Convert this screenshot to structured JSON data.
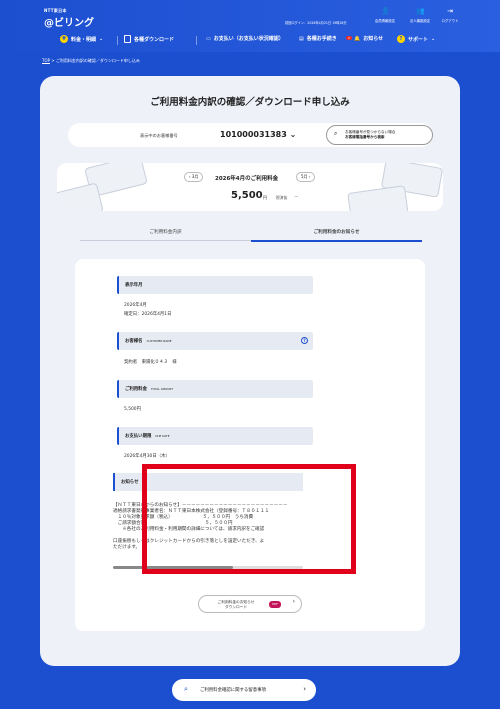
{
  "header": {
    "logo_top": "NTT東日本",
    "logo_main": "@ビリング",
    "last_login": "前回ログイン：2026年4月21日 19時18分",
    "top_icons": [
      {
        "label": "会員情報設定",
        "icon": "person-icon"
      },
      {
        "label": "法人機能設定",
        "icon": "group-icon"
      },
      {
        "label": "ログアウト",
        "icon": "logout-icon"
      }
    ]
  },
  "nav": {
    "items": [
      {
        "label": "料金・明細",
        "icon": "yen-icon"
      },
      {
        "label": "各種ダウンロード",
        "icon": "document-icon"
      },
      {
        "label": "お支払い（お支払い状況確認）",
        "icon": "card-icon"
      },
      {
        "label": "各種お手続き",
        "icon": "form-icon"
      },
      {
        "label": "お知らせ",
        "icon": "bell-icon"
      },
      {
        "label": "サポート",
        "icon": "support-icon"
      }
    ],
    "notice_badge": "2"
  },
  "breadcrumb": {
    "home": "TOP",
    "sep": ">",
    "current": "ご利用料金内訳の確認／ダウンロード申し込み"
  },
  "page_title": "ご利用料金内訳の確認／ダウンロード申し込み",
  "account": {
    "label": "表示中のお客様番号",
    "number": "101000031383",
    "help_line1": "お客様番号が見つからない場合",
    "help_line2": "お客様電話番号から検索"
  },
  "month": {
    "prev": "3月",
    "title": "2026年4月のご利用料金",
    "next": "5月",
    "amount": "5,500",
    "yen": "円",
    "tax": "税済抜",
    "dash": "－"
  },
  "tabs": [
    {
      "label": "ご利用料金内訳"
    },
    {
      "label": "ご利用料金のお知らせ"
    }
  ],
  "sections": {
    "display_month": {
      "title": "表示年月",
      "line1": "2026年4月",
      "line2": "確定日：2026年4月1日"
    },
    "customer": {
      "title": "お客様名",
      "sub": "CUSTOMER NAME",
      "value": "契約者　東陽化０４３　様"
    },
    "total": {
      "title": "ご利用料金",
      "sub": "TOTAL AMOUNT",
      "value": "5,500円"
    },
    "due": {
      "title": "お支払い期限",
      "sub": "DUE DATE",
      "value": "2026年4月30日（木）"
    }
  },
  "notice": {
    "title": "お知らせ",
    "lines": [
      "【ＮＴＴ東日本からのお知らせ】－－－－－－－－－－－－－－－－－－－－－－－",
      "適格請求書発行事業者名：ＮＴＴ東日本株式会社（登録番号：Ｔ８０１１１",
      "　１０％対象請求額（税込）　　　　　　　５，５００円　うち消費",
      "　ご請求額合計　　　　　　　　　　　　　５，５００円",
      "　　※各社のご利用料金・利用期間の詳細については、請求内訳をご確認",
      "",
      "口座振替もしくはクレジットカードからの引き落としを設定いただき、よ",
      "ただけます。"
    ]
  },
  "download": {
    "line1": "ご利用料金のお知らせ",
    "line2": "ダウンロード",
    "pdf": "PDF"
  },
  "bottom_link": "ご利用料金確認に関する留意事項"
}
